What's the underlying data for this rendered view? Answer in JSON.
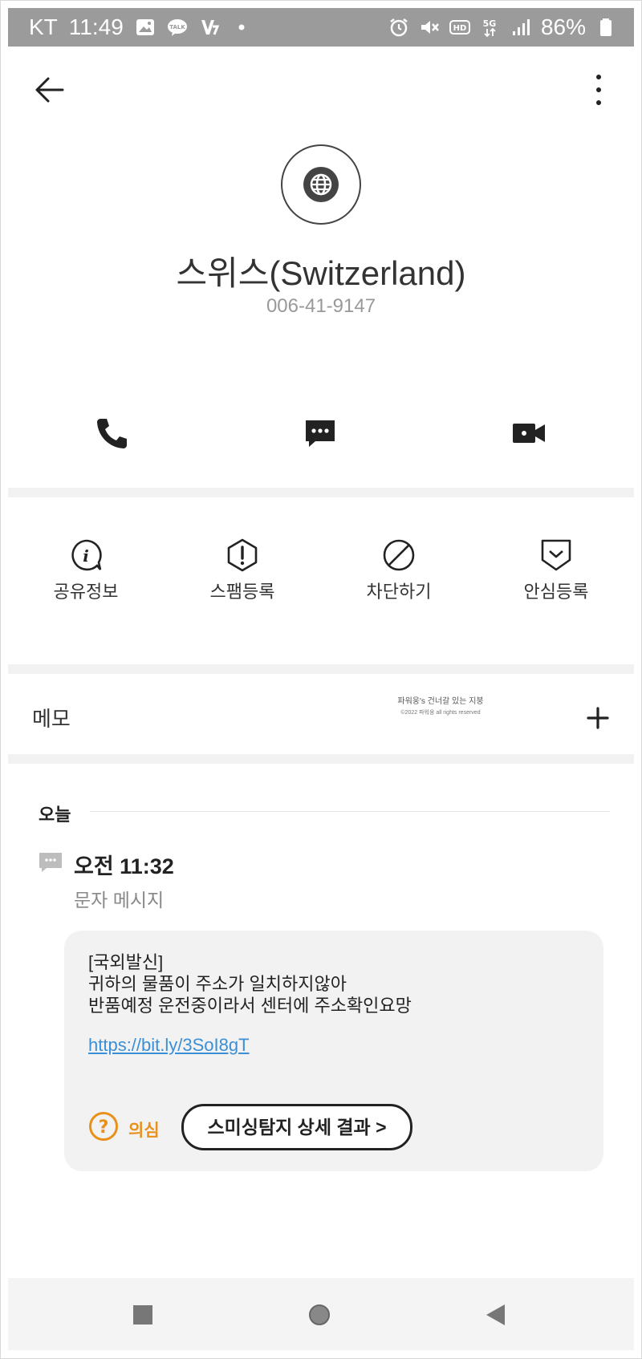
{
  "status_bar": {
    "carrier": "KT",
    "time": "11:49",
    "battery": "86%",
    "left_icons": [
      "image-icon",
      "kakao-talk-icon",
      "v3-icon",
      "dot-icon"
    ],
    "right_icons": [
      "alarm-icon",
      "mute-icon",
      "hd-icon",
      "5g-icon",
      "signal-icon",
      "battery-icon"
    ]
  },
  "app_bar": {
    "back_icon": "arrow-left-icon",
    "more_icon": "more-vertical-icon"
  },
  "contact": {
    "avatar_icon": "globe-icon",
    "name": "스위스(Switzerland)",
    "number": "006-41-9147"
  },
  "quick_actions": [
    {
      "name": "call",
      "icon": "phone-icon"
    },
    {
      "name": "message",
      "icon": "message-icon"
    },
    {
      "name": "video-call",
      "icon": "video-icon"
    }
  ],
  "tools": [
    {
      "label": "공유정보",
      "icon": "info-icon"
    },
    {
      "label": "스팸등록",
      "icon": "spam-icon"
    },
    {
      "label": "차단하기",
      "icon": "block-icon"
    },
    {
      "label": "안심등록",
      "icon": "safe-icon"
    }
  ],
  "memo": {
    "label": "메모",
    "add_icon": "plus-icon"
  },
  "watermark": {
    "line1": "파워웅's 건너갈 있는 지붕",
    "line2": "©2022 파워웅 all rights reserved"
  },
  "history": {
    "section_label": "오늘",
    "entry": {
      "time": "오전 11:32",
      "type": "문자 메시지",
      "icon": "message-bubble-icon",
      "body": "[국외발신]\n귀하의 물품이 주소가 일치하지않아\n반품예정 운전중이라서 센터에 주소확인요망",
      "link": "https://bit.ly/3SoI8gT",
      "suspect_label": "의심",
      "detail_button": "스미싱탐지 상세 결과 >"
    }
  },
  "colors": {
    "status_bar": "#9b9b9b",
    "divider": "#f2f2f2",
    "bubble": "#f2f2f2",
    "link": "#3a8fd6",
    "warning": "#e8901a"
  },
  "nav_bar": {
    "icons": [
      "recent-apps-icon",
      "home-icon",
      "back-triangle-icon"
    ]
  }
}
